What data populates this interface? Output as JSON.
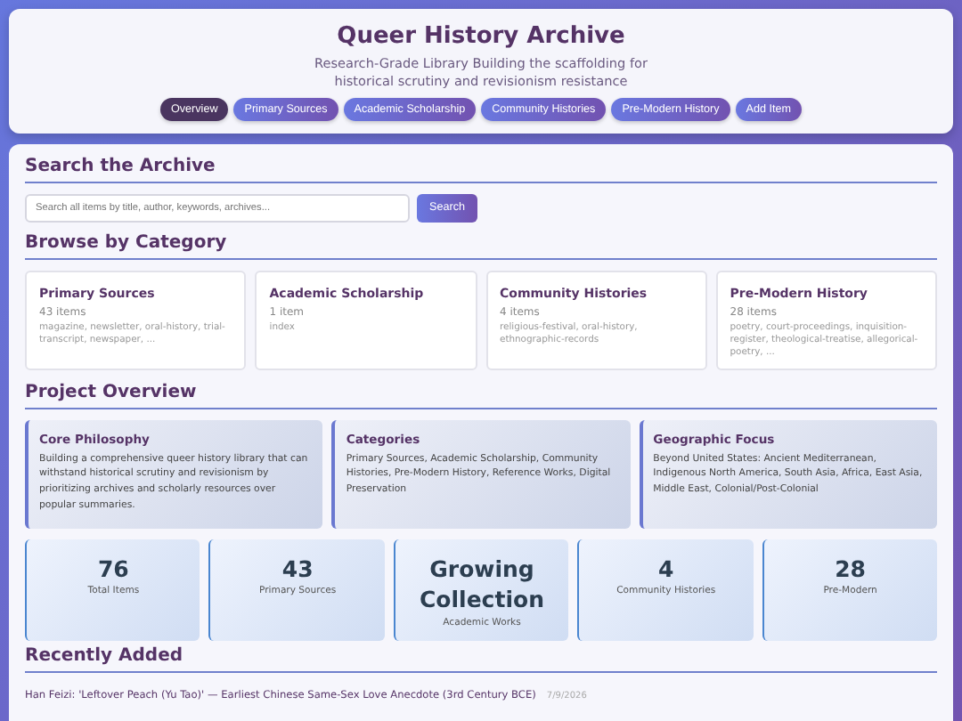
{
  "header": {
    "title": "Queer History Archive",
    "subtitle": "Research-Grade Library Building the scaffolding for historical scrutiny and revisionism resistance"
  },
  "nav": [
    {
      "label": "Overview",
      "selected": true
    },
    {
      "label": "Primary Sources",
      "selected": false
    },
    {
      "label": "Academic Scholarship",
      "selected": false
    },
    {
      "label": "Community Histories",
      "selected": false
    },
    {
      "label": "Pre-Modern History",
      "selected": false
    },
    {
      "label": "Add Item",
      "selected": false
    }
  ],
  "search": {
    "heading": "Search the Archive",
    "placeholder": "Search all items by title, author, keywords, archives...",
    "button": "Search"
  },
  "categories": {
    "heading": "Browse by Category",
    "items": [
      {
        "title": "Primary Sources",
        "count": "43 items",
        "tags": "magazine, newsletter, oral-history, trial-transcript, newspaper, ..."
      },
      {
        "title": "Academic Scholarship",
        "count": "1 item",
        "tags": "index"
      },
      {
        "title": "Community Histories",
        "count": "4 items",
        "tags": "religious-festival, oral-history, ethnographic-records"
      },
      {
        "title": "Pre-Modern History",
        "count": "28 items",
        "tags": "poetry, court-proceedings, inquisition-register, theological-treatise, allegorical-poetry, ..."
      }
    ]
  },
  "overview": {
    "heading": "Project Overview",
    "cards": [
      {
        "title": "Core Philosophy",
        "text": "Building a comprehensive queer history library that can withstand historical scrutiny and revisionism by prioritizing archives and scholarly resources over popular summaries."
      },
      {
        "title": "Categories",
        "text": "Primary Sources, Academic Scholarship, Community Histories, Pre-Modern History, Reference Works, Digital Preservation"
      },
      {
        "title": "Geographic Focus",
        "text": "Beyond United States: Ancient Mediterranean, Indigenous North America, South Asia, Africa, East Asia, Middle East, Colonial/Post-Colonial"
      }
    ],
    "stats": [
      {
        "value": "76",
        "label": "Total Items"
      },
      {
        "value": "43",
        "label": "Primary Sources"
      },
      {
        "value": "Growing Collection",
        "label": "Academic Works"
      },
      {
        "value": "4",
        "label": "Community Histories"
      },
      {
        "value": "28",
        "label": "Pre-Modern"
      }
    ]
  },
  "recent": {
    "heading": "Recently Added",
    "items": [
      {
        "title": "Han Feizi: 'Leftover Peach (Yu Tao)' — Earliest Chinese Same-Sex Love Anecdote (3rd Century BCE)",
        "date": "7/9/2026"
      }
    ]
  }
}
